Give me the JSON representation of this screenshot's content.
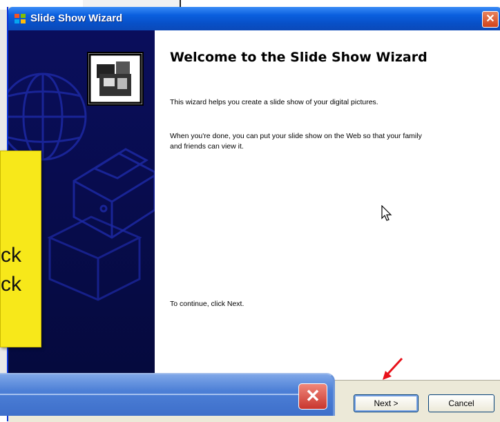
{
  "window": {
    "title": "Slide Show Wizard",
    "close_glyph": "✕"
  },
  "content": {
    "heading": "Welcome to the Slide Show Wizard",
    "paragraph1": "This wizard helps you create a slide show of your digital pictures.",
    "paragraph2": "When you're done, you can put your slide show on the Web so that your family and friends can view it.",
    "continue_text": "To continue, click Next."
  },
  "buttons": {
    "next": "Next >",
    "cancel": "Cancel"
  },
  "callout": {
    "line1": "ck",
    "line2": "ck"
  },
  "taskbar": {
    "close_glyph": "✕"
  },
  "icons": [
    "windows-logo-icon",
    "close-icon",
    "slideshow-wizard-icon",
    "globe-icon",
    "printer-icon",
    "mouse-cursor-icon",
    "red-arrow-icon"
  ],
  "colors": {
    "title_bar": "#0a5fde",
    "side_panel": "#0a0e5c",
    "callout": "#f7e81a",
    "arrow": "#e8111a"
  }
}
